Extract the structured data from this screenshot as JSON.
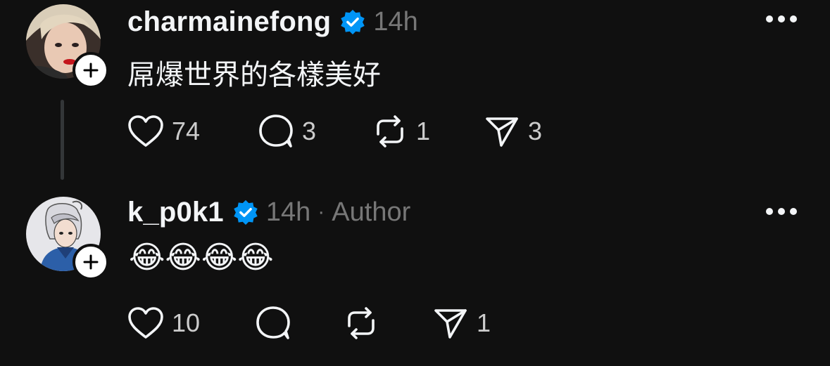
{
  "comments": [
    {
      "username": "charmainefong",
      "verified": true,
      "time": "14h",
      "author_tag": "",
      "text": "屌爆世界的各樣美好",
      "actions": {
        "likes": "74",
        "replies": "3",
        "reposts": "1",
        "shares": "3"
      }
    },
    {
      "username": "k_p0k1",
      "verified": true,
      "time": "14h",
      "separator": "·",
      "author_tag": "Author",
      "text": "😂😂😂😂",
      "actions": {
        "likes": "10",
        "replies": "",
        "reposts": "",
        "shares": "1"
      }
    }
  ],
  "icons": {
    "like": "heart-icon",
    "reply": "speech-bubble-icon",
    "repost": "repost-icon",
    "share": "paper-plane-icon",
    "follow": "plus-icon",
    "verified": "verified-badge-icon",
    "more": "more-options-icon"
  },
  "colors": {
    "background": "#101010",
    "text": "#f3f5f7",
    "muted": "#777777",
    "verified": "#0095f6"
  }
}
